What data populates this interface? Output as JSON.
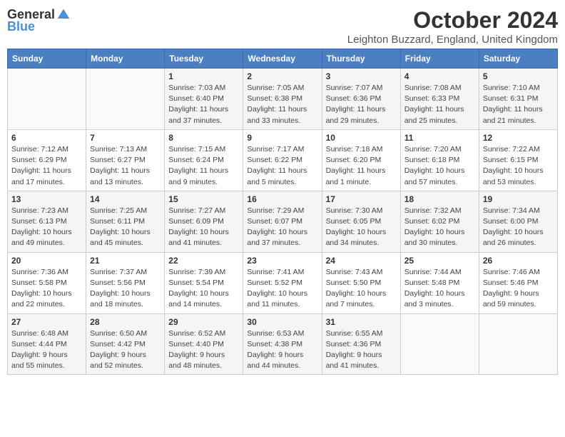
{
  "logo": {
    "general": "General",
    "blue": "Blue"
  },
  "title": "October 2024",
  "subtitle": "Leighton Buzzard, England, United Kingdom",
  "days_of_week": [
    "Sunday",
    "Monday",
    "Tuesday",
    "Wednesday",
    "Thursday",
    "Friday",
    "Saturday"
  ],
  "weeks": [
    [
      {
        "day": "",
        "info": ""
      },
      {
        "day": "",
        "info": ""
      },
      {
        "day": "1",
        "info": "Sunrise: 7:03 AM\nSunset: 6:40 PM\nDaylight: 11 hours and 37 minutes."
      },
      {
        "day": "2",
        "info": "Sunrise: 7:05 AM\nSunset: 6:38 PM\nDaylight: 11 hours and 33 minutes."
      },
      {
        "day": "3",
        "info": "Sunrise: 7:07 AM\nSunset: 6:36 PM\nDaylight: 11 hours and 29 minutes."
      },
      {
        "day": "4",
        "info": "Sunrise: 7:08 AM\nSunset: 6:33 PM\nDaylight: 11 hours and 25 minutes."
      },
      {
        "day": "5",
        "info": "Sunrise: 7:10 AM\nSunset: 6:31 PM\nDaylight: 11 hours and 21 minutes."
      }
    ],
    [
      {
        "day": "6",
        "info": "Sunrise: 7:12 AM\nSunset: 6:29 PM\nDaylight: 11 hours and 17 minutes."
      },
      {
        "day": "7",
        "info": "Sunrise: 7:13 AM\nSunset: 6:27 PM\nDaylight: 11 hours and 13 minutes."
      },
      {
        "day": "8",
        "info": "Sunrise: 7:15 AM\nSunset: 6:24 PM\nDaylight: 11 hours and 9 minutes."
      },
      {
        "day": "9",
        "info": "Sunrise: 7:17 AM\nSunset: 6:22 PM\nDaylight: 11 hours and 5 minutes."
      },
      {
        "day": "10",
        "info": "Sunrise: 7:18 AM\nSunset: 6:20 PM\nDaylight: 11 hours and 1 minute."
      },
      {
        "day": "11",
        "info": "Sunrise: 7:20 AM\nSunset: 6:18 PM\nDaylight: 10 hours and 57 minutes."
      },
      {
        "day": "12",
        "info": "Sunrise: 7:22 AM\nSunset: 6:15 PM\nDaylight: 10 hours and 53 minutes."
      }
    ],
    [
      {
        "day": "13",
        "info": "Sunrise: 7:23 AM\nSunset: 6:13 PM\nDaylight: 10 hours and 49 minutes."
      },
      {
        "day": "14",
        "info": "Sunrise: 7:25 AM\nSunset: 6:11 PM\nDaylight: 10 hours and 45 minutes."
      },
      {
        "day": "15",
        "info": "Sunrise: 7:27 AM\nSunset: 6:09 PM\nDaylight: 10 hours and 41 minutes."
      },
      {
        "day": "16",
        "info": "Sunrise: 7:29 AM\nSunset: 6:07 PM\nDaylight: 10 hours and 37 minutes."
      },
      {
        "day": "17",
        "info": "Sunrise: 7:30 AM\nSunset: 6:05 PM\nDaylight: 10 hours and 34 minutes."
      },
      {
        "day": "18",
        "info": "Sunrise: 7:32 AM\nSunset: 6:02 PM\nDaylight: 10 hours and 30 minutes."
      },
      {
        "day": "19",
        "info": "Sunrise: 7:34 AM\nSunset: 6:00 PM\nDaylight: 10 hours and 26 minutes."
      }
    ],
    [
      {
        "day": "20",
        "info": "Sunrise: 7:36 AM\nSunset: 5:58 PM\nDaylight: 10 hours and 22 minutes."
      },
      {
        "day": "21",
        "info": "Sunrise: 7:37 AM\nSunset: 5:56 PM\nDaylight: 10 hours and 18 minutes."
      },
      {
        "day": "22",
        "info": "Sunrise: 7:39 AM\nSunset: 5:54 PM\nDaylight: 10 hours and 14 minutes."
      },
      {
        "day": "23",
        "info": "Sunrise: 7:41 AM\nSunset: 5:52 PM\nDaylight: 10 hours and 11 minutes."
      },
      {
        "day": "24",
        "info": "Sunrise: 7:43 AM\nSunset: 5:50 PM\nDaylight: 10 hours and 7 minutes."
      },
      {
        "day": "25",
        "info": "Sunrise: 7:44 AM\nSunset: 5:48 PM\nDaylight: 10 hours and 3 minutes."
      },
      {
        "day": "26",
        "info": "Sunrise: 7:46 AM\nSunset: 5:46 PM\nDaylight: 9 hours and 59 minutes."
      }
    ],
    [
      {
        "day": "27",
        "info": "Sunrise: 6:48 AM\nSunset: 4:44 PM\nDaylight: 9 hours and 55 minutes."
      },
      {
        "day": "28",
        "info": "Sunrise: 6:50 AM\nSunset: 4:42 PM\nDaylight: 9 hours and 52 minutes."
      },
      {
        "day": "29",
        "info": "Sunrise: 6:52 AM\nSunset: 4:40 PM\nDaylight: 9 hours and 48 minutes."
      },
      {
        "day": "30",
        "info": "Sunrise: 6:53 AM\nSunset: 4:38 PM\nDaylight: 9 hours and 44 minutes."
      },
      {
        "day": "31",
        "info": "Sunrise: 6:55 AM\nSunset: 4:36 PM\nDaylight: 9 hours and 41 minutes."
      },
      {
        "day": "",
        "info": ""
      },
      {
        "day": "",
        "info": ""
      }
    ]
  ]
}
